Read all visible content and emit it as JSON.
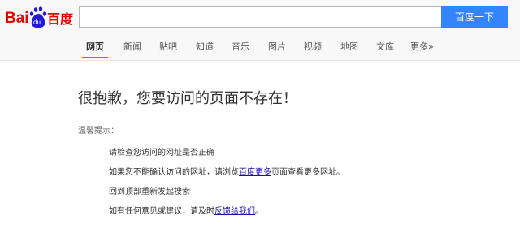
{
  "logo": {
    "text_bai": "Bai",
    "text_du": "du",
    "text_cn": "百度"
  },
  "search": {
    "value": "",
    "placeholder": "",
    "button_label": "百度一下"
  },
  "nav": {
    "items": [
      {
        "label": "网页",
        "active": true
      },
      {
        "label": "新闻"
      },
      {
        "label": "贴吧"
      },
      {
        "label": "知道"
      },
      {
        "label": "音乐"
      },
      {
        "label": "图片"
      },
      {
        "label": "视频"
      },
      {
        "label": "地图"
      },
      {
        "label": "文库"
      },
      {
        "label": "更多»"
      }
    ]
  },
  "main": {
    "title": "很抱歉，您要访问的页面不存在！",
    "hint_label": "温馨提示：",
    "tip1": "请检查您访问的网址是否正确",
    "tip2_before": "如果您不能确认访问的网址，请浏览",
    "tip2_link": "百度更多",
    "tip2_after": "页面查看更多网址。",
    "tip3": "回到顶部重新发起搜索",
    "tip4_before": "如有任何意见或建议，请及时",
    "tip4_link": "反馈给我们",
    "tip4_after": "。"
  },
  "colors": {
    "accent": "#3385ff",
    "logo_red": "#e10602",
    "logo_blue": "#2319dc",
    "link": "#1a0dab"
  }
}
